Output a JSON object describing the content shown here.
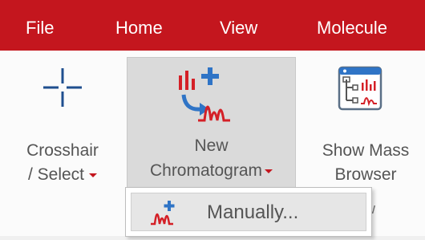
{
  "menu": {
    "items": [
      {
        "label": "File"
      },
      {
        "label": "Home"
      },
      {
        "label": "View"
      },
      {
        "label": "Molecule"
      }
    ]
  },
  "ribbon": {
    "crosshair": {
      "line1": "Crosshair",
      "line2": "/ Select",
      "icon": "crosshair-icon"
    },
    "new_chromatogram": {
      "line1": "New",
      "line2": "Chromatogram",
      "icon": "new-chromatogram-icon"
    },
    "show_mass_browser": {
      "line1": "Show Mass",
      "line2": "Browser",
      "icon": "mass-browser-icon"
    },
    "group_label_fragment": "w"
  },
  "dropdown": {
    "items": [
      {
        "label": "Manually...",
        "icon": "chromatogram-add-icon"
      }
    ]
  },
  "colors": {
    "menubar": "#c4161e",
    "accent_red": "#d42027",
    "accent_blue": "#2f74c6",
    "crosshair_blue": "#1f4f8f",
    "selected_bg": "#dadada"
  }
}
